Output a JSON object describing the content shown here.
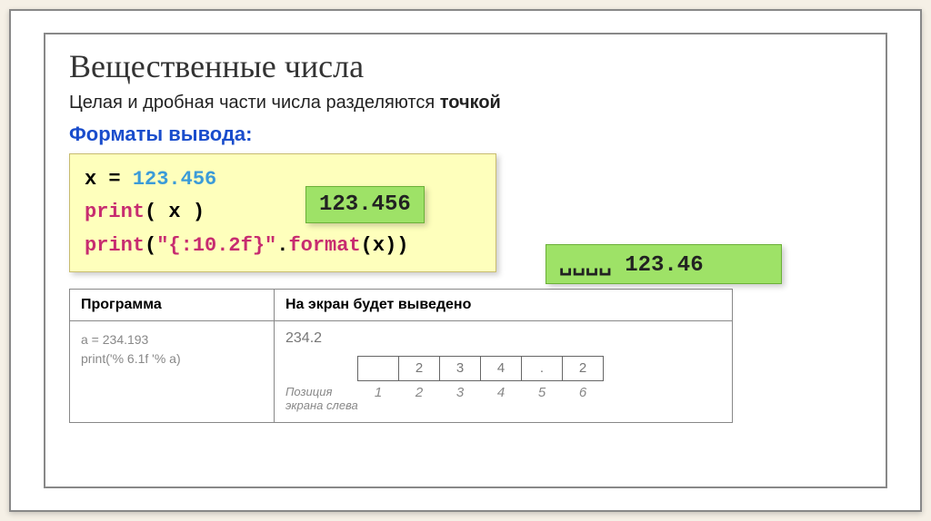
{
  "title": "Вещественные числа",
  "subtitle_prefix": "Целая и дробная части числа разделяются ",
  "subtitle_bold": "точкой",
  "section_label": "Форматы вывода:",
  "code": {
    "line1_var": "x",
    "line1_eq": " = ",
    "line1_num": "123.456",
    "line2_fn": "print",
    "line2_args": "( x )",
    "line3_fn": "print",
    "line3_open": "(",
    "line3_str": "\"{:10.2f}\"",
    "line3_dot": ".",
    "line3_fmt": "format",
    "line3_close": "(x))"
  },
  "output1": "123.456",
  "output2": "␣␣␣␣ 123.46",
  "table": {
    "header_prog": "Программа",
    "header_out": "На экран будет выведено",
    "prog_line1": "a = 234.193",
    "prog_line2": "print('% 6.1f '% a)",
    "out_value": "234.2",
    "cells": [
      "",
      "2",
      "3",
      "4",
      ".",
      "2"
    ],
    "pos_label": "Позиция экрана слева",
    "positions": [
      "1",
      "2",
      "3",
      "4",
      "5",
      "6"
    ]
  }
}
